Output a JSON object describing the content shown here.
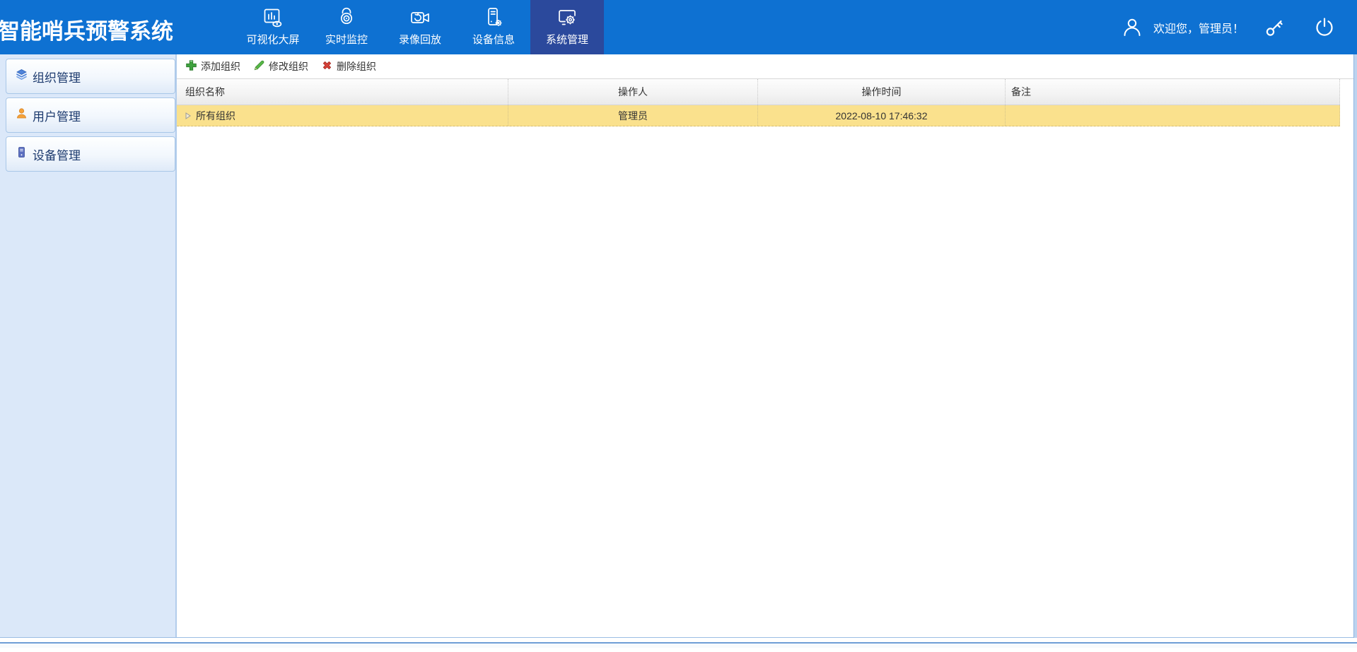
{
  "app": {
    "title": "智能哨兵预警系统"
  },
  "topnav": {
    "items": [
      {
        "label": "可视化大屏",
        "icon": "dashboard-screen-icon",
        "active": false
      },
      {
        "label": "实时监控",
        "icon": "live-camera-icon",
        "active": false
      },
      {
        "label": "录像回放",
        "icon": "video-playback-icon",
        "active": false
      },
      {
        "label": "设备信息",
        "icon": "device-info-icon",
        "active": false
      },
      {
        "label": "系统管理",
        "icon": "system-settings-icon",
        "active": true
      }
    ]
  },
  "userbar": {
    "welcome": "欢迎您，管理员！",
    "icons": [
      "user-icon",
      "key-icon",
      "power-icon"
    ]
  },
  "sidebar": {
    "items": [
      {
        "label": "组织管理",
        "icon": "org-layers-icon"
      },
      {
        "label": "用户管理",
        "icon": "user-orange-icon"
      },
      {
        "label": "设备管理",
        "icon": "device-blue-icon"
      }
    ]
  },
  "toolbar": {
    "buttons": [
      {
        "label": "添加组织",
        "icon": "add-icon"
      },
      {
        "label": "修改组织",
        "icon": "edit-icon"
      },
      {
        "label": "删除组织",
        "icon": "delete-icon"
      }
    ]
  },
  "table": {
    "columns": [
      {
        "label": "组织名称"
      },
      {
        "label": "操作人"
      },
      {
        "label": "操作时间"
      },
      {
        "label": "备注"
      }
    ],
    "rows": [
      {
        "name": "所有组织",
        "operator": "管理员",
        "time": "2022-08-10 17:46:32",
        "remark": "",
        "selected": true
      }
    ]
  },
  "colors": {
    "topbar_blue": "#0e71d2",
    "active_nav_blue": "#2b499c",
    "sidebar_bg": "#dbe8f9",
    "selected_row_yellow": "#fae18d",
    "add_green": "#3fa33f",
    "edit_green": "#57b947",
    "delete_red": "#d9433b"
  }
}
